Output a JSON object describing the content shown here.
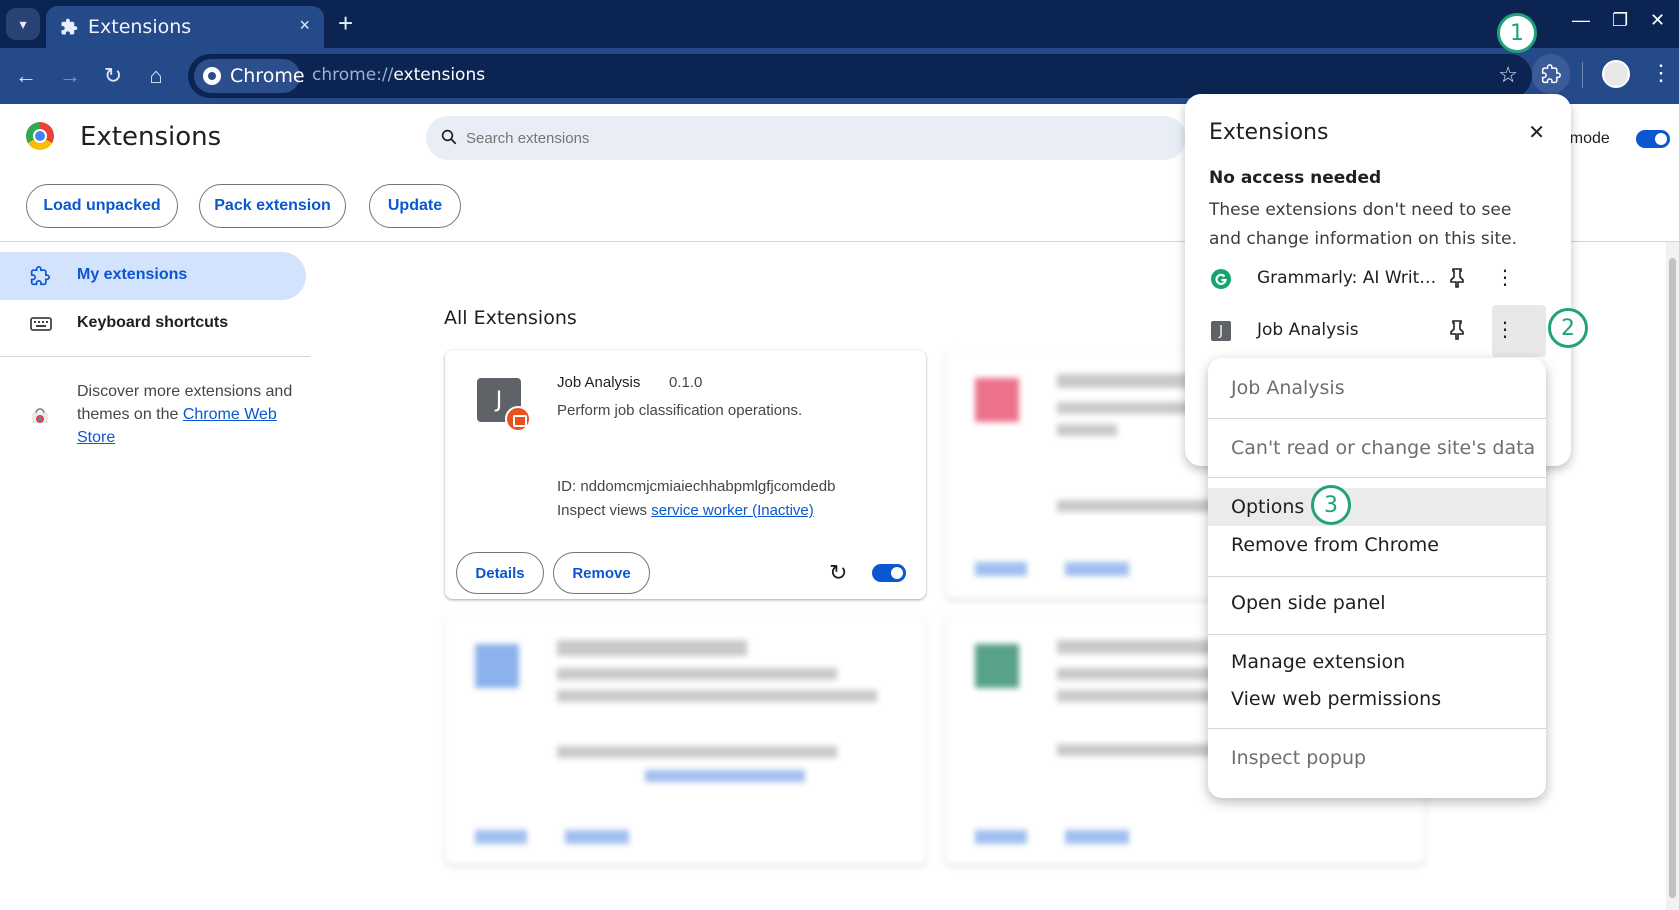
{
  "browser": {
    "tab_title": "Extensions",
    "tab_close": "×",
    "new_tab": "+",
    "omnibox_chip": "Chrome",
    "url_scheme": "chrome://",
    "url_host": "extensions",
    "window_minimize": "—",
    "window_restore": "❐",
    "window_close": "✕"
  },
  "badges": [
    "1",
    "2",
    "3"
  ],
  "page": {
    "title": "Extensions",
    "search_placeholder": "Search extensions",
    "developer_mode_label": "r mode",
    "developer_mode_on": true
  },
  "actions": {
    "load_unpacked": "Load unpacked",
    "pack_extension": "Pack extension",
    "update": "Update"
  },
  "sidebar": {
    "items": [
      {
        "label": "My extensions",
        "icon": "extension-icon",
        "active": true
      },
      {
        "label": "Keyboard shortcuts",
        "icon": "keyboard-icon",
        "active": false
      }
    ],
    "discover_text": "Discover more extensions and themes on the ",
    "discover_link": "Chrome Web Store"
  },
  "main": {
    "section_title": "All Extensions",
    "card": {
      "icon_letter": "J",
      "name": "Job Analysis",
      "version": "0.1.0",
      "description": "Perform job classification operations.",
      "id_line": "ID: nddomcmjcmiaiechhabpmlgfjcomdedb",
      "inspect_label": "Inspect views ",
      "inspect_link": "service worker (Inactive)",
      "details_btn": "Details",
      "remove_btn": "Remove",
      "enabled": true
    }
  },
  "popup": {
    "title": "Extensions",
    "close": "✕",
    "subtitle": "No access needed",
    "description": "These extensions don't need to see and change information on this site.",
    "items": [
      {
        "name": "Grammarly: AI Writ…",
        "icon": "grammarly-icon"
      },
      {
        "name": "Job Analysis",
        "icon": "job-analysis-icon",
        "letter": "J"
      }
    ]
  },
  "context_menu": {
    "header": "Job Analysis",
    "site_access": "Can't read or change site's data",
    "options": "Options",
    "remove": "Remove from Chrome",
    "side_panel": "Open side panel",
    "manage": "Manage extension",
    "permissions": "View web permissions",
    "inspect": "Inspect popup"
  },
  "colors": {
    "accent": "#0b57d0",
    "tabbar": "#0c2452",
    "toolbar": "#244a8a",
    "badge": "#1fa37a"
  }
}
